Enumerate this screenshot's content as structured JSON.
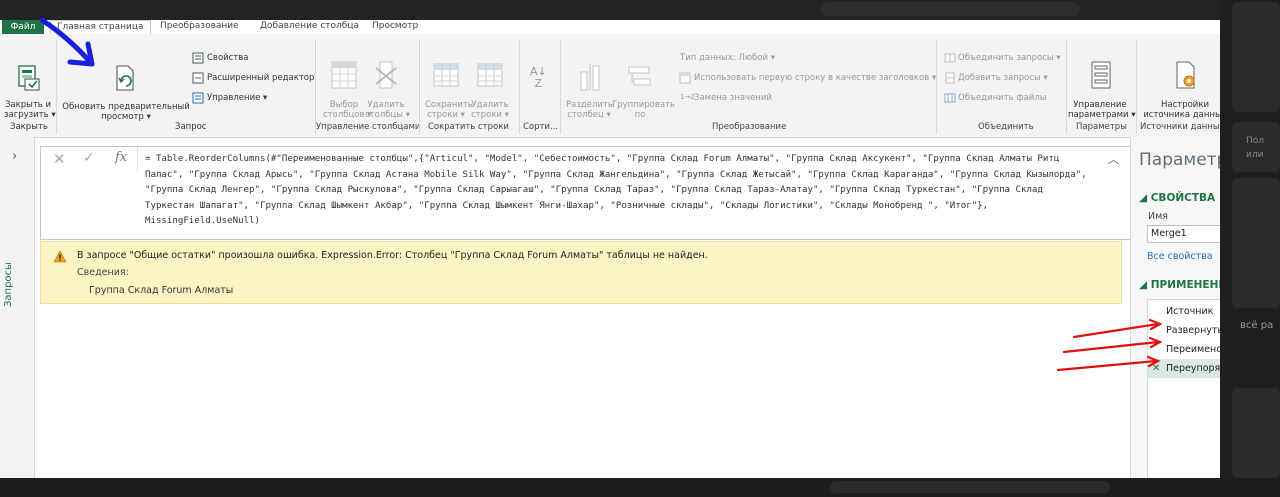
{
  "tabs": {
    "file": "Файл",
    "home": "Главная страница",
    "transform": "Преобразование",
    "add_column": "Добавление столбца",
    "view": "Просмотр"
  },
  "ribbon": {
    "close_load": "Закрыть и",
    "close_load2": "загрузить ▾",
    "group_close": "Закрыть",
    "refresh1": "Обновить предварительный",
    "refresh2": "просмотр ▾",
    "properties": "Свойства",
    "advanced_editor": "Расширенный редактор",
    "manage": "Управление ▾",
    "group_query": "Запрос",
    "choose1": "Выбор",
    "choose2": "столбцов ▾",
    "remove1": "Удалить",
    "remove2": "столбцы ▾",
    "group_manage_cols": "Управление столбцами",
    "keep1": "Сохранить",
    "keep2": "строки ▾",
    "removerows1": "Удалить",
    "removerows2": "строки ▾",
    "group_reduce_rows": "Сократить строки",
    "group_sort": "Сорти...",
    "split1": "Разделить",
    "split2": "столбец ▾",
    "group1": "Группировать",
    "group2": "по",
    "datatype": "Тип данных: Любой ▾",
    "first_row": "Использовать первую строку в качестве заголовков ▾",
    "replace_values": "Замена значений",
    "group_transform": "Преобразование",
    "merge_queries": "Объединить запросы ▾",
    "append_queries": "Добавить запросы ▾",
    "combine_files": "Объединить файлы",
    "group_combine": "Объединить",
    "manage_params1": "Управление",
    "manage_params2": "параметрами ▾",
    "group_params": "Параметры",
    "ds_settings1": "Настройки",
    "ds_settings2": "источника данных",
    "group_ds": "Источники данных"
  },
  "left_panel": {
    "label": "Запросы"
  },
  "formula": {
    "text": "= Table.ReorderColumns(#\"Переименованные столбцы\",{\"Articul\", \"Model\", \"Себестоимость\", \"Группа Склад Forum Алматы\", \"Группа Склад Аксукент\", \"Группа Склад Алматы Ритц Палас\", \"Группа Склад Арысь\", \"Группа Склад Астана Mobile Silk Way\", \"Группа Склад Жангельдина\", \"Группа Склад Жетысай\", \"Группа Склад Караганда\", \"Группа Склад Кызылорда\", \"Группа Склад Ленгер\", \"Группа Склад Рыскулова\", \"Группа Склад Сарыагаш\", \"Группа Склад Тараз\", \"Группа Склад Тараз-Алатау\", \"Группа Склад Туркестан\", \"Группа Склад Туркестан Шапагат\", \"Группа Склад Шымкент Акбар\", \"Группа Склад Шымкент Янги-Шахар\", \"Розничные склады\", \"Склады Логистики\", \"Склады Монобренд \", \"Итог\"}, MissingField.UseNull)"
  },
  "error": {
    "message": "В запросе \"Общие остатки\" произошла ошибка. Expression.Error: Столбец \"Группа Склад Forum Алматы\" таблицы не найден.",
    "details_label": "Сведения:",
    "column": "Группа Склад Forum Алматы"
  },
  "params": {
    "title": "Параметры",
    "properties_header": "◢ СВОЙСТВА",
    "name_label": "Имя",
    "name_value": "Merge1",
    "all_props": "Все свойства",
    "applied_header": "◢ ПРИМЕНЕННЫЕ",
    "steps": [
      "Источник",
      "Развернуты",
      "Переимено",
      "Переупоряд"
    ]
  },
  "right_blur": {
    "text1": "Пол",
    "text2": "или",
    "text3": "всё ра"
  },
  "colors": {
    "accent": "#217346",
    "error_bg": "#fdf4c4",
    "annotation_blue": "#1a1fd8",
    "annotation_red": "#e01010"
  }
}
